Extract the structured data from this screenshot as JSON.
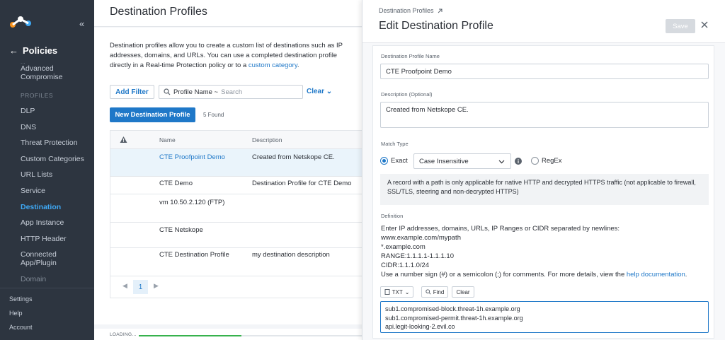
{
  "sidebar": {
    "back_label": "Policies",
    "faded_text": "...",
    "items_top": [
      {
        "label": "Advanced\nCompromise"
      }
    ],
    "section_label": "PROFILES",
    "items": [
      {
        "label": "DLP"
      },
      {
        "label": "DNS"
      },
      {
        "label": "Threat Protection"
      },
      {
        "label": "Custom Categories"
      },
      {
        "label": "URL Lists"
      },
      {
        "label": "Service"
      },
      {
        "label": "Destination"
      },
      {
        "label": "App Instance"
      },
      {
        "label": "HTTP Header"
      },
      {
        "label": "Connected\nApp/Plugin"
      },
      {
        "label": "Domain"
      }
    ],
    "bottom": [
      {
        "label": "Settings"
      },
      {
        "label": "Help"
      },
      {
        "label": "Account"
      }
    ]
  },
  "main": {
    "title": "Destination Profiles",
    "description_pre": "Destination profiles allow you to create a custom list of destinations such as IP addresses, domains, and URLs. You can use a completed destination profile directly in a Real-time Protection policy or to a ",
    "description_link": "custom category",
    "description_post": ".",
    "add_filter": "Add Filter",
    "search_label": "Profile Name ~",
    "search_placeholder": "Search",
    "clear_label": "Clear",
    "new_button": "New Destination Profile",
    "found": "5 Found",
    "columns": {
      "name": "Name",
      "description": "Description"
    },
    "rows": [
      {
        "name": "CTE Proofpoint Demo",
        "description": "Created from Netskope CE."
      },
      {
        "name": "CTE Demo",
        "description": "Destination Profile for CTE Demo"
      },
      {
        "name": "vm 10.50.2.120 (FTP)",
        "description": ""
      },
      {
        "name": "CTE Netskope",
        "description": ""
      },
      {
        "name": "CTE Destination Profile",
        "description": "my destination description"
      }
    ],
    "page": "1",
    "loading_text": "LOADING...",
    "loading_progress": 0.46
  },
  "edit": {
    "breadcrumb": "Destination Profiles",
    "title": "Edit Destination Profile",
    "save": "Save",
    "name_label": "Destination Profile Name",
    "name_value": "CTE Proofpoint Demo",
    "desc_label": "Description (Optional)",
    "desc_value": "Created from Netskope CE.",
    "match_label": "Match Type",
    "exact_label": "Exact",
    "case_value": "Case Insensitive",
    "regex_label": "RegEx",
    "note": "A record with a path is only applicable for native HTTP and decrypted HTTPS traffic (not applicable to firewall, SSL/TLS, steering and non-decrypted HTTPS)",
    "definition_label": "Definition",
    "def_lines": [
      "Enter IP addresses, domains, URLs, IP Ranges or CIDR separated by newlines:",
      "www.example.com/mypath",
      "*.example.com",
      "RANGE:1.1.1.1-1.1.1.10",
      "CIDR:1.1.1.0/24"
    ],
    "def_comment_pre": "Use a number sign (#) or a semicolon (;) for comments. For more details, view the ",
    "def_comment_link": "help documentation",
    "def_comment_post": ".",
    "txt_label": "TXT",
    "find_label": "Find",
    "clear_label": "Clear",
    "editor_lines": [
      "sub1.compromised-block.threat-1h.example.org",
      "sub1.compromised-permit.threat-1h.example.org",
      "api.legit-looking-2.evil.co"
    ]
  }
}
